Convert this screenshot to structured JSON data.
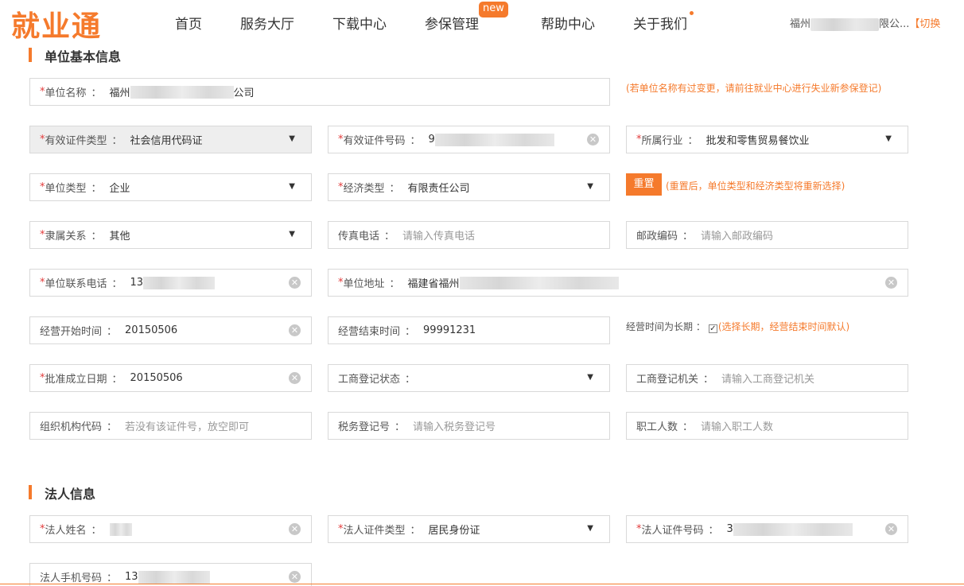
{
  "header": {
    "logo": "就业通",
    "nav": [
      "首页",
      "服务大厅",
      "下载中心",
      "参保管理",
      "帮助中心",
      "关于我们"
    ],
    "new_badge": "new",
    "user_prefix": "福州",
    "user_suffix": "限公...",
    "switch_label": "【切换"
  },
  "section_unit": {
    "title": "单位基本信息"
  },
  "section_legal": {
    "title": "法人信息"
  },
  "fields": {
    "unit_name": {
      "label": "单位名称",
      "value_prefix": "福州",
      "value_suffix": "公司"
    },
    "cert_type": {
      "label": "有效证件类型",
      "value": "社会信用代码证"
    },
    "cert_no": {
      "label": "有效证件号码",
      "value_prefix": "9"
    },
    "industry": {
      "label": "所属行业",
      "value": "批发和零售贸易餐饮业"
    },
    "unit_type": {
      "label": "单位类型",
      "value": "企业"
    },
    "econ_type": {
      "label": "经济类型",
      "value": "有限责任公司"
    },
    "affiliation": {
      "label": "隶属关系",
      "value": "其他"
    },
    "fax": {
      "label": "传真电话",
      "placeholder": "请输入传真电话"
    },
    "postcode": {
      "label": "邮政编码",
      "placeholder": "请输入邮政编码"
    },
    "phone": {
      "label": "单位联系电话",
      "value_prefix": "13"
    },
    "address": {
      "label": "单位地址",
      "value_prefix": "福建省福州"
    },
    "biz_start": {
      "label": "经营开始时间",
      "value": "20150506"
    },
    "biz_end": {
      "label": "经营结束时间",
      "value": "99991231"
    },
    "approve_date": {
      "label": "批准成立日期",
      "value": "20150506"
    },
    "reg_status": {
      "label": "工商登记状态",
      "value": ""
    },
    "reg_office": {
      "label": "工商登记机关",
      "placeholder": "请输入工商登记机关"
    },
    "org_code": {
      "label": "组织机构代码",
      "placeholder": "若没有该证件号，放空即可"
    },
    "tax_no": {
      "label": "税务登记号",
      "placeholder": "请输入税务登记号"
    },
    "staff_count": {
      "label": "职工人数",
      "placeholder": "请输入职工人数"
    },
    "legal_name": {
      "label": "法人姓名"
    },
    "legal_cert_type": {
      "label": "法人证件类型",
      "value": "居民身份证"
    },
    "legal_cert_no": {
      "label": "法人证件号码",
      "value_prefix": "3"
    },
    "legal_mobile": {
      "label": "法人手机号码",
      "value_prefix": "13"
    }
  },
  "tips": {
    "name_change": "(若单位名称有过变更，请前往就业中心进行失业新参保登记)",
    "reset_note": "(重置后，单位类型和经济类型将重新选择)",
    "longterm_label": "经营时间为长期",
    "longterm_note": "(选择长期，经营结束时间默认)"
  },
  "buttons": {
    "reset": "重置"
  },
  "icons": {
    "dropdown": "▼",
    "clear": "✕",
    "check": "✓"
  },
  "colors": {
    "accent": "#f57a2c",
    "required": "#e23b3b"
  }
}
